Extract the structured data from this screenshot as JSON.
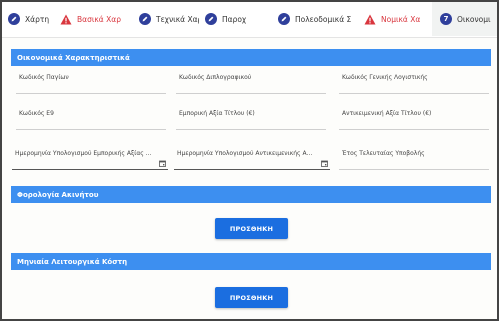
{
  "tabs": [
    {
      "label": "Χάρτη",
      "icon": "pencil-icon",
      "status": "normal"
    },
    {
      "label": "Βασικά Χαρ",
      "icon": "warning-icon",
      "status": "error"
    },
    {
      "label": "Τεχνικά Χαρ",
      "icon": "pencil-icon",
      "status": "normal"
    },
    {
      "label": "Παροχ",
      "icon": "pencil-icon",
      "status": "normal"
    },
    {
      "label": "Πολεοδομικά Σ",
      "icon": "pencil-icon",
      "status": "normal"
    },
    {
      "label": "Νομικά Χαρ",
      "icon": "warning-icon",
      "status": "error"
    },
    {
      "label": "Οικονομι",
      "number": "7",
      "status": "active"
    }
  ],
  "sections": {
    "financial": {
      "title": "Οικονομικά Χαρακτηριστικά",
      "fields": [
        {
          "label": "Κωδικός Παγίων",
          "value": ""
        },
        {
          "label": "Κωδικός Διπλογραφικού",
          "value": ""
        },
        {
          "label": "Κωδικός Γενικής Λογιστικής",
          "value": ""
        },
        {
          "label": "Κωδικός Ε9",
          "value": ""
        },
        {
          "label": "Εμπορική Αξία Τίτλου (€)",
          "value": ""
        },
        {
          "label": "Αντικειμενική Αξία Τίτλου (€)",
          "value": ""
        },
        {
          "label": "Ημερομηνία Υπολογισμού Εμπορικής Αξίας ...",
          "value": ""
        },
        {
          "label": "Ημερομηνία Υπολογισμού Αντικειμενικής Α...",
          "value": ""
        },
        {
          "label": "Έτος Τελευταίας Υποβολής",
          "value": ""
        }
      ]
    },
    "taxation": {
      "title": "Φορολογία Ακινήτου",
      "button": "ΠΡΟΣΘΗΚΗ"
    },
    "monthly_costs": {
      "title": "Μηνιαία Λειτουργικά Κόστη",
      "button": "ΠΡΟΣΘΗΚΗ"
    }
  },
  "colors": {
    "section_header": "#3d8ff0",
    "button": "#1b6ee0",
    "error": "#d9363e",
    "active_tab_circle": "#2f3f9b"
  }
}
